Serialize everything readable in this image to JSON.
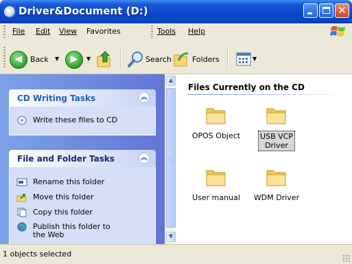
{
  "window": {
    "title": "Driver&Document (D:)"
  },
  "menu": {
    "items": [
      "File",
      "Edit",
      "View",
      "Favorites",
      "Tools",
      "Help"
    ]
  },
  "toolbar": {
    "back_label": "Back",
    "search_label": "Search",
    "folders_label": "Folders"
  },
  "tasks": {
    "cd_group_title": "CD Writing Tasks",
    "cd_items": [
      "Write these files to CD"
    ],
    "folder_group_title": "File and Folder Tasks",
    "folder_items": [
      "Rename this folder",
      "Move this folder",
      "Copy this folder",
      "Publish this folder to",
      "the Web"
    ]
  },
  "content": {
    "section_title": "Files Currently on the CD",
    "folders": [
      {
        "name": "OPOS Object",
        "selected": false
      },
      {
        "name": "USB VCP",
        "name2": "Driver",
        "selected": true
      },
      {
        "name": "User manual",
        "selected": false
      },
      {
        "name": "WDM Driver",
        "selected": false
      }
    ]
  },
  "status": {
    "text": "1 objects selected"
  },
  "colors": {
    "title_blue": "#0a48cf",
    "task_pane_blue": "#6f8fde",
    "group_title": "#215dc6",
    "folder_yellow": "#f8d775"
  }
}
